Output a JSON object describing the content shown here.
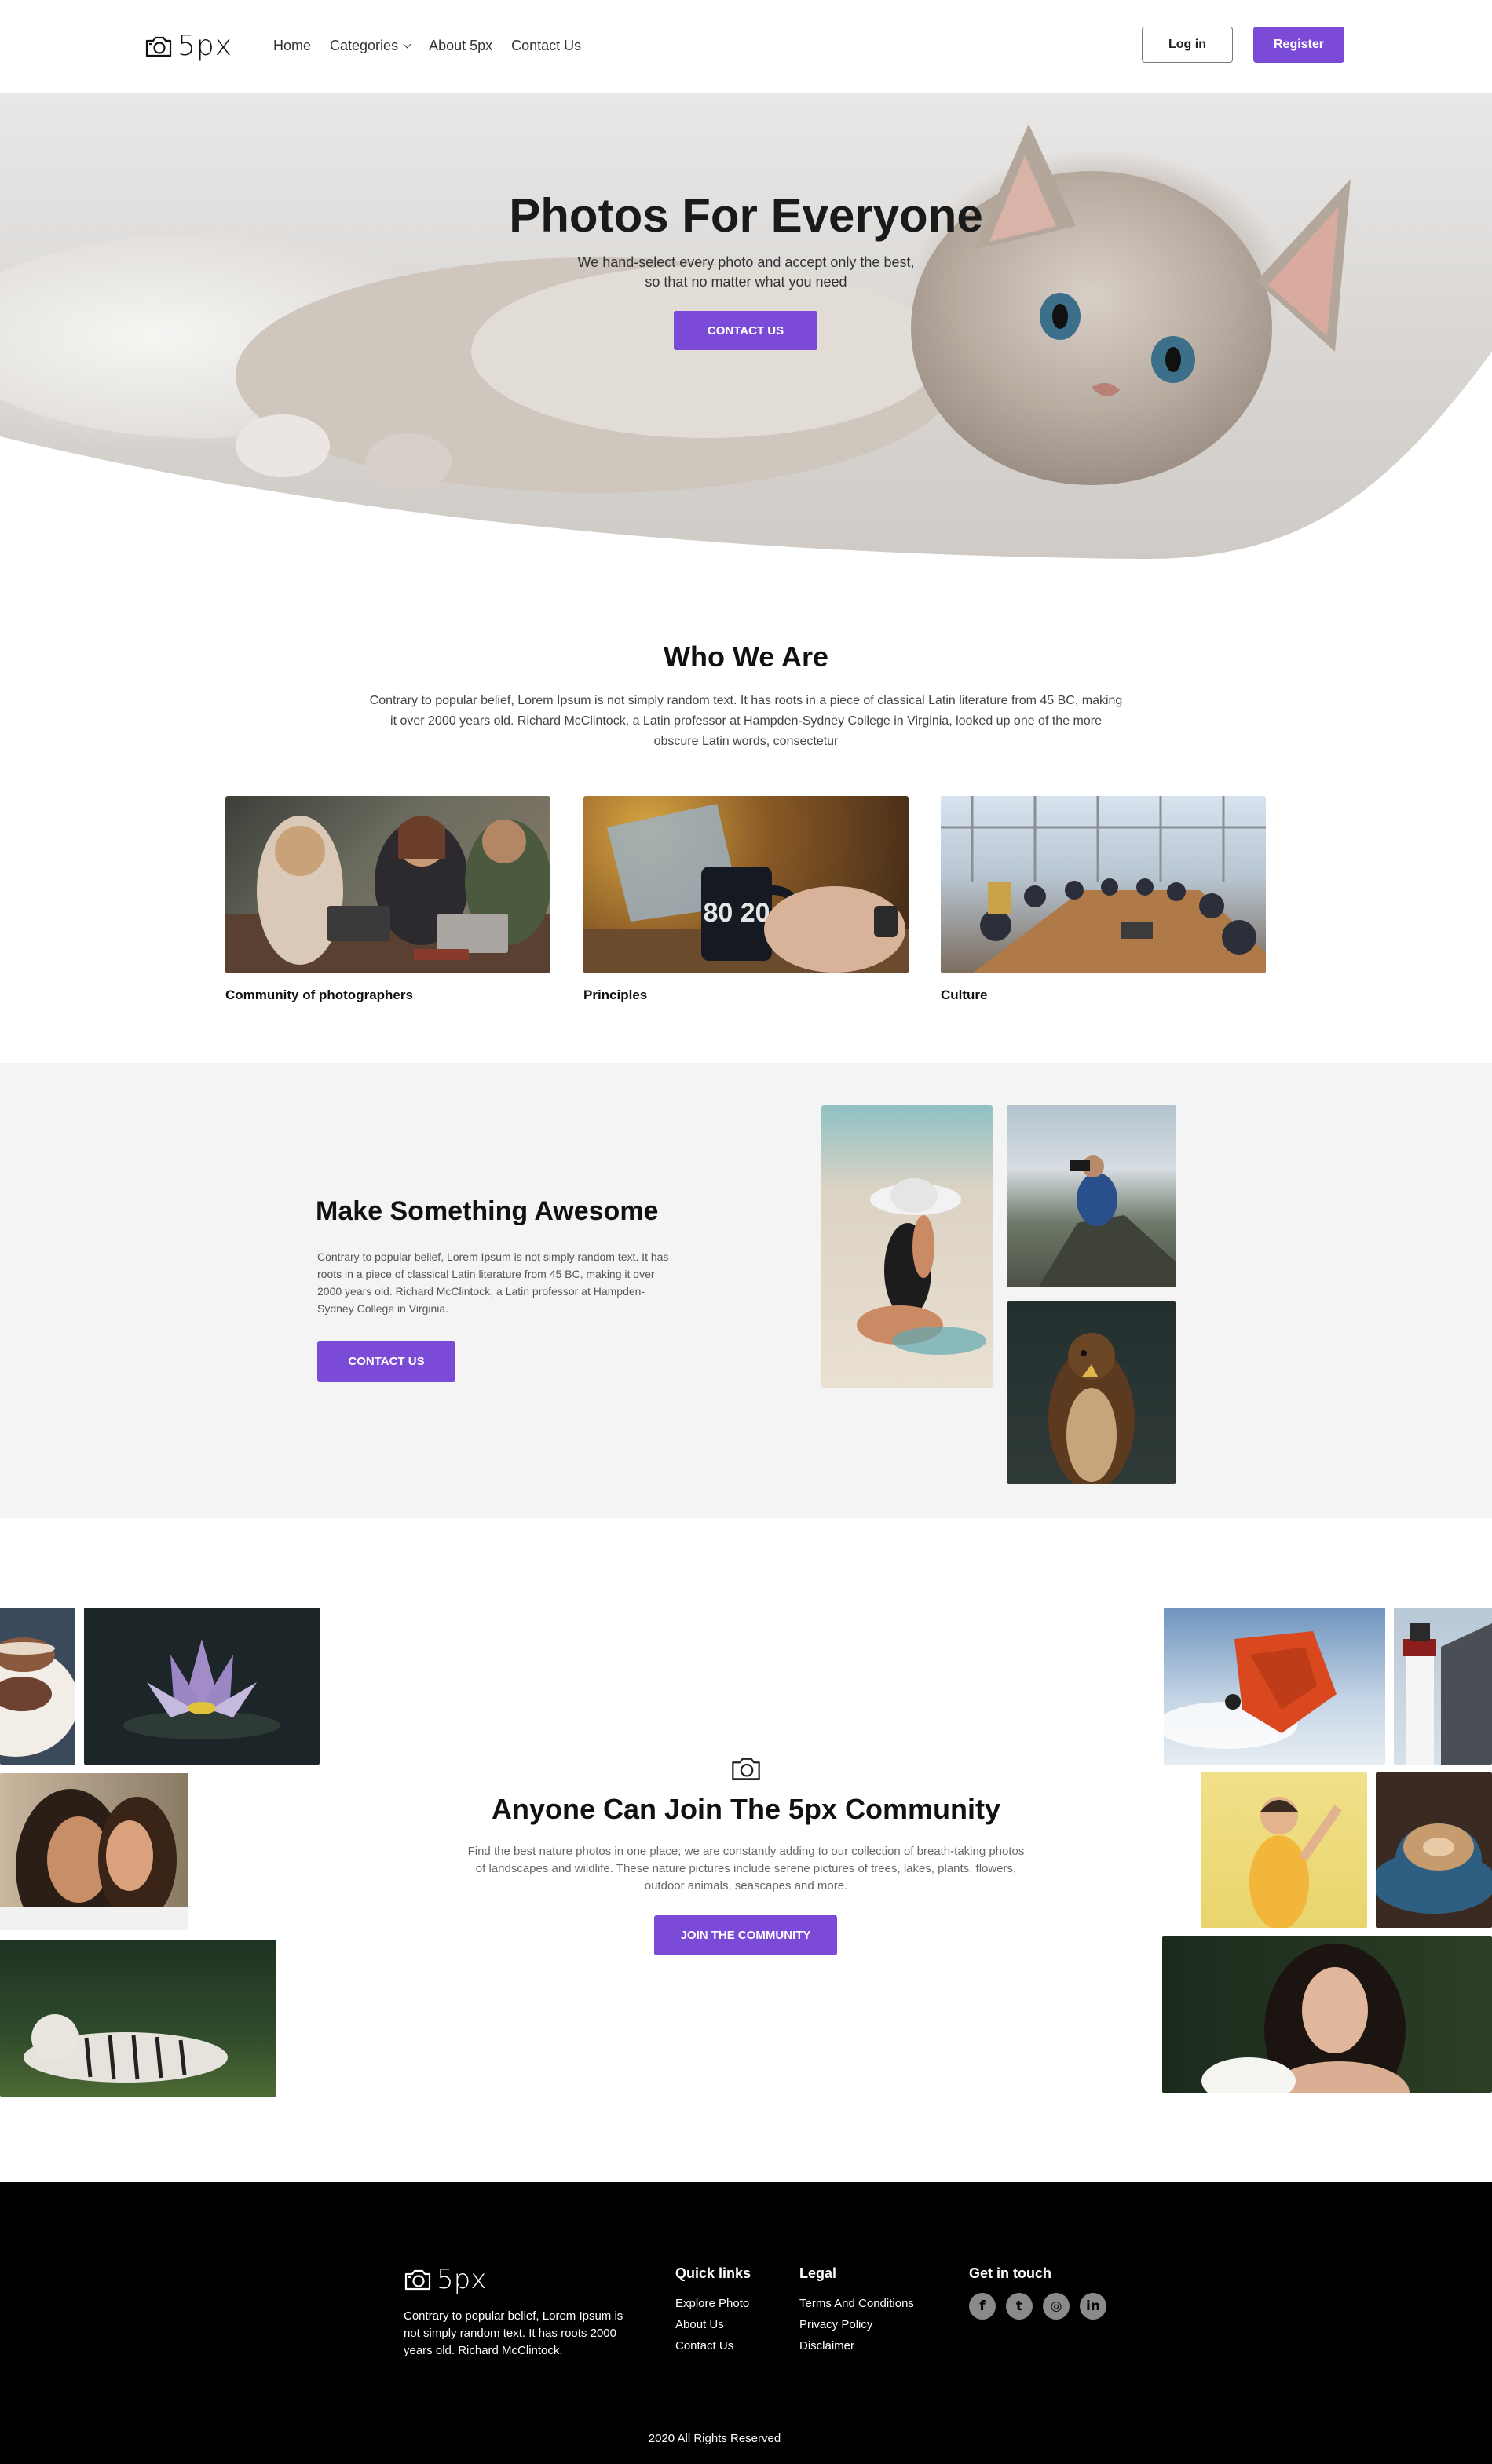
{
  "header": {
    "logo_text": "5px",
    "nav": [
      "Home",
      "Categories",
      "About 5px",
      "Contact Us"
    ],
    "login_label": "Log in",
    "register_label": "Register"
  },
  "hero": {
    "title": "Photos For Everyone",
    "subtitle_line1": "We hand-select every photo and accept only the best,",
    "subtitle_line2": "so that no matter what you need",
    "button_label": "CONTACT US"
  },
  "who": {
    "title": "Who We Are",
    "text": "Contrary to popular belief, Lorem Ipsum is not simply random text. It has roots in a piece of classical Latin literature from 45 BC, making it over 2000 years old. Richard McClintock, a Latin professor at Hampden-Sydney College in Virginia, looked up one of the more obscure Latin words, consectetur",
    "cards": [
      {
        "caption": "Community of photographers"
      },
      {
        "caption": "Principles",
        "mug_text": "80 20"
      },
      {
        "caption": "Culture"
      }
    ]
  },
  "awesome": {
    "title": "Make Something Awesome",
    "text": "Contrary to popular belief, Lorem Ipsum is not simply random text. It has roots in a piece of classical Latin literature from 45 BC, making it over 2000 years old. Richard McClintock, a Latin professor at Hampden-Sydney College in Virginia.",
    "button_label": "CONTACT US"
  },
  "community": {
    "title": "Anyone Can Join The 5px Community",
    "text": "Find the best nature photos in one place; we are constantly adding to our collection of breath-taking photos of landscapes and wildlife. These nature pictures include serene pictures of trees, lakes, plants, flowers, outdoor animals, seascapes and more.",
    "button_label": "JOIN THE COMMUNITY"
  },
  "footer": {
    "logo_text": "5px",
    "about": "Contrary to popular belief, Lorem Ipsum is not simply random text. It has roots 2000 years old. Richard McClintock.",
    "quick_links_title": "Quick links",
    "quick_links": [
      "Explore Photo",
      "About Us",
      "Contact Us"
    ],
    "legal_title": "Legal",
    "legal_links": [
      "Terms And Conditions",
      "Privacy Policy",
      "Disclaimer"
    ],
    "contact_title": "Get in touch",
    "socials": [
      {
        "icon": "facebook-icon",
        "glyph": "f"
      },
      {
        "icon": "twitter-icon",
        "glyph": "t"
      },
      {
        "icon": "instagram-icon",
        "glyph": "◎"
      },
      {
        "icon": "linkedin-icon",
        "glyph": "in"
      }
    ],
    "copyright": "2020 All Rights Reserved"
  },
  "colors": {
    "accent": "#7b4bd8",
    "section_bg": "#f4f4f4",
    "footer_bg": "#000000"
  }
}
